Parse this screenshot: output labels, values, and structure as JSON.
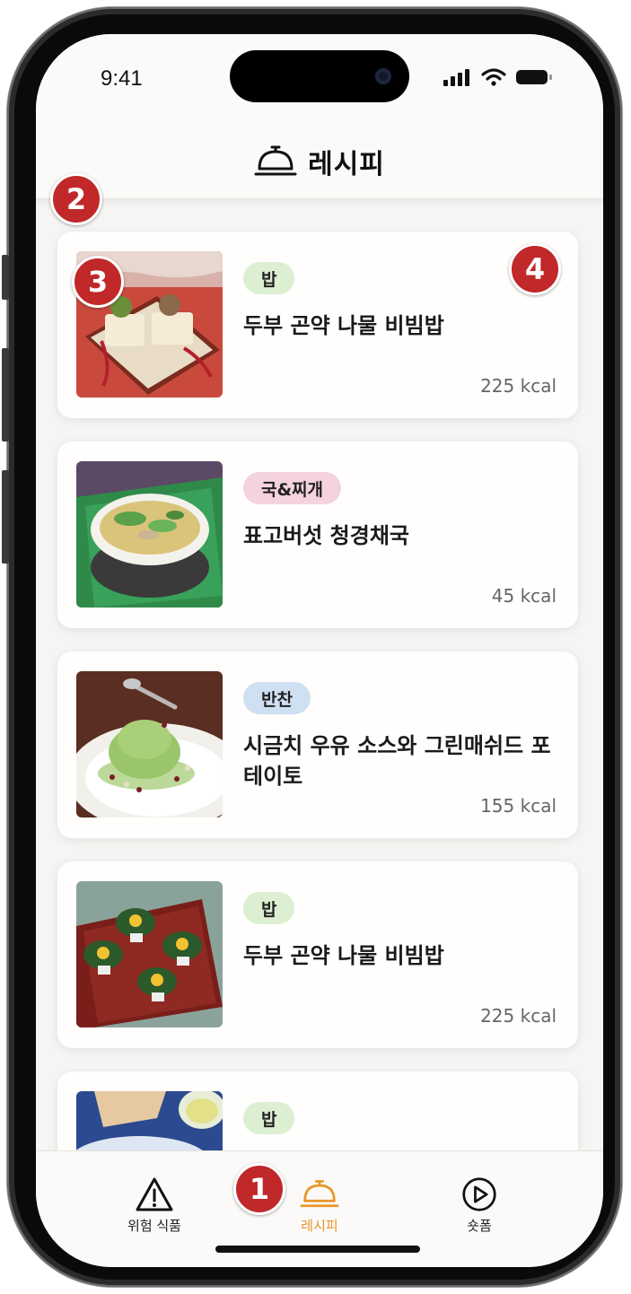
{
  "status_bar": {
    "time": "9:41"
  },
  "header": {
    "title": "레시피",
    "icon": "cloche-icon"
  },
  "recipes": [
    {
      "tag": "밥",
      "tag_color": "#dcefd2",
      "title": "두부 곤약 나물 비빔밥",
      "kcal": "225 kcal",
      "image": "tofu-bibimbap-photo"
    },
    {
      "tag": "국&찌개",
      "tag_color": "#f5d3dc",
      "title": "표고버섯 청경채국",
      "kcal": "45 kcal",
      "image": "mushroom-bokchoy-soup-photo"
    },
    {
      "tag": "반찬",
      "tag_color": "#cfe0f2",
      "title": "시금치 우유 소스와 그린매쉬드 포테이토",
      "kcal": "155 kcal",
      "image": "green-mashed-potato-photo"
    },
    {
      "tag": "밥",
      "tag_color": "#dcefd2",
      "title": "두부 곤약 나물 비빔밥",
      "kcal": "225 kcal",
      "image": "lettuce-cups-photo"
    },
    {
      "tag": "밥",
      "tag_color": "#dcefd2",
      "title": "",
      "kcal": "",
      "image": "blue-plate-photo"
    }
  ],
  "tabbar": {
    "items": [
      {
        "label": "위험 식품",
        "icon": "warning-icon"
      },
      {
        "label": "레시피",
        "icon": "cloche-icon",
        "active": true
      },
      {
        "label": "숏폼",
        "icon": "play-circle-icon"
      }
    ],
    "active_color": "#e8962a"
  },
  "annotations": {
    "badge1": "1",
    "badge2": "2",
    "badge3": "3",
    "badge4": "4"
  }
}
